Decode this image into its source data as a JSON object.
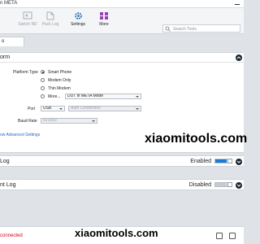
{
  "window": {
    "title": "n META"
  },
  "toolbar": {
    "switch_nd": "Switch ND",
    "pack_log": "Pack Log",
    "settings": "Settings",
    "more": "More"
  },
  "search": {
    "placeholder": "Search Tools"
  },
  "tabs": [
    {
      "label": "o"
    }
  ],
  "platform": {
    "title": "orm",
    "platform_type_label": "Platform Type",
    "options": [
      "Smart Phone",
      "Modem Only",
      "Thin Modem",
      "More..."
    ],
    "selected_option": "Smart Phone",
    "more_mode": "DUT in META Mode",
    "port_label": "Port",
    "port_value": "USB",
    "port_conn": "Auto Connection",
    "baud_label": "Baud Rate",
    "baud_value": "921600",
    "advanced_link": "ow Advanced Settings"
  },
  "log1": {
    "title": "Log",
    "state_label": "Enabled",
    "enabled": true
  },
  "log2": {
    "title": "nt Log",
    "state_label": "Disabled",
    "enabled": false
  },
  "status": {
    "text": "connected"
  },
  "watermarks": [
    "xiaomitools.com",
    "xiaomitools.com"
  ],
  "icons": [
    "switch-nd-icon",
    "pack-log-icon",
    "settings-icon",
    "more-icon",
    "search-icon",
    "chevron-up-icon",
    "chevron-down-icon"
  ],
  "colors": {
    "accent": "#1e7ad9",
    "status_error": "#d0021b",
    "link": "#2469c7"
  }
}
